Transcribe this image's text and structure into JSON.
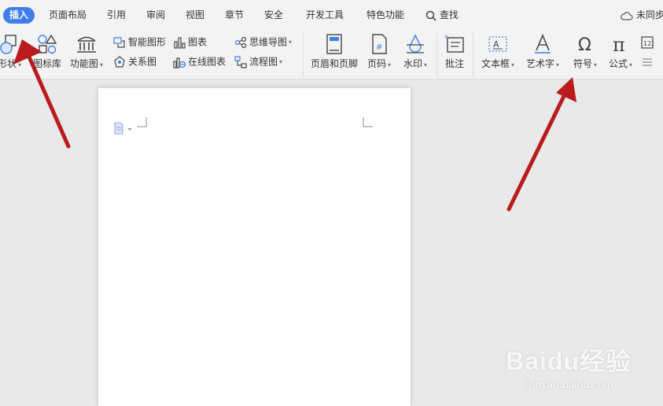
{
  "tabs": [
    {
      "label": "插入",
      "active": true
    },
    {
      "label": "页面布局"
    },
    {
      "label": "引用"
    },
    {
      "label": "审阅"
    },
    {
      "label": "视图"
    },
    {
      "label": "章节"
    },
    {
      "label": "安全"
    },
    {
      "label": "开发工具"
    },
    {
      "label": "特色功能"
    }
  ],
  "search_label": "查找",
  "sync_label": "未同步",
  "ribbon": {
    "shape": "形状",
    "icon_lib": "图标库",
    "function_chart": "功能图",
    "smart_art": "智能图形",
    "chart": "图表",
    "mind_map": "思维导图",
    "relation_chart": "关系图",
    "online_chart": "在线图表",
    "flow_chart": "流程图",
    "header_footer": "页眉和页脚",
    "page_number": "页码",
    "watermark": "水印",
    "comment": "批注",
    "text_box": "文本框",
    "word_art": "艺术字",
    "symbol": "符号",
    "formula": "公式",
    "caret": "▾"
  },
  "watermark": {
    "logo": "Baidu经验",
    "url": "jingyan.baidu.com"
  },
  "colors": {
    "accent": "#3f7ee8",
    "arrow": "#b81c1c",
    "ribbon_bg": "#f3f3f3",
    "canvas": "#e9e9e9"
  }
}
